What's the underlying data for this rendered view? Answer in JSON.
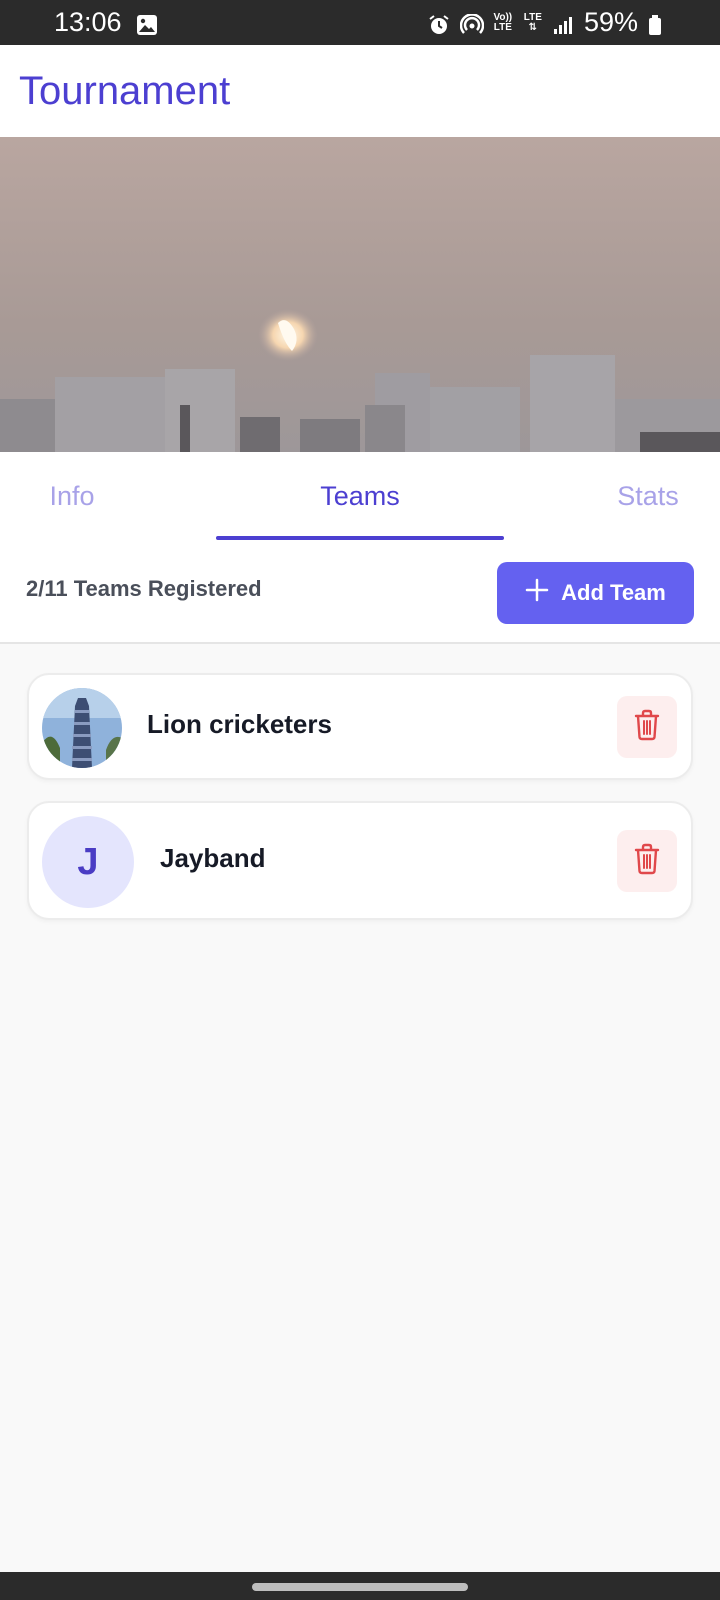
{
  "status_bar": {
    "time": "13:06",
    "volte": "Vo)) LTE",
    "lte": "LTE",
    "battery": "59%"
  },
  "app_bar": {
    "title": "Tournament"
  },
  "tabs": [
    {
      "label": "Info",
      "active": false
    },
    {
      "label": "Teams",
      "active": true
    },
    {
      "label": "Stats",
      "active": false
    }
  ],
  "teams_header": {
    "count_text": "2/11 Teams Registered",
    "add_button_label": "Add Team"
  },
  "teams": [
    {
      "name": "Lion cricketers",
      "avatar": "photo"
    },
    {
      "name": "Jayband",
      "avatar_letter": "J"
    }
  ],
  "colors": {
    "accent": "#4c3fd1",
    "button": "#6461f0",
    "delete": "#e0484b",
    "delete_bg": "#fdeeee"
  }
}
